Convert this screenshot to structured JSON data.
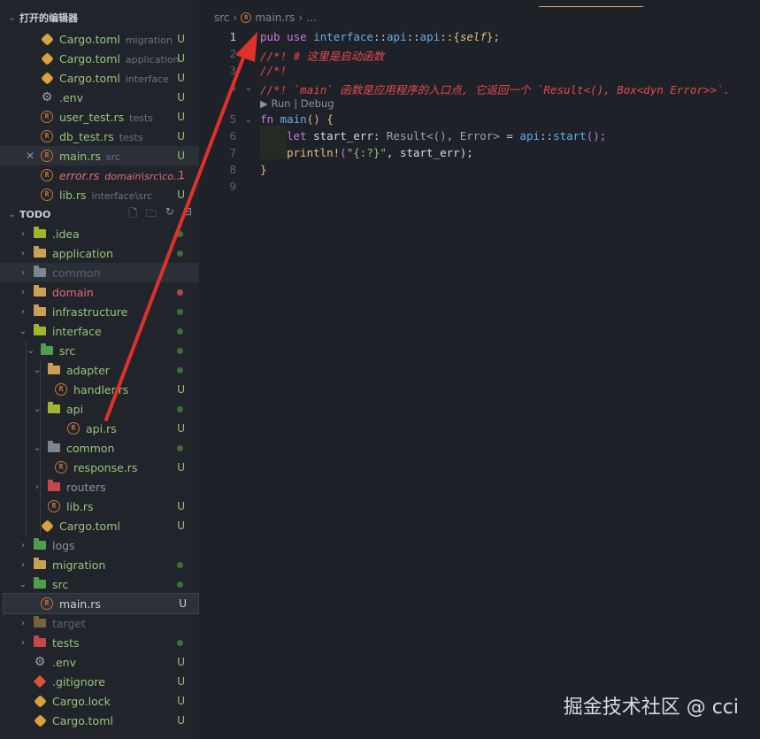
{
  "open_editors": {
    "title": "打开的编辑器",
    "items": [
      {
        "icon": "cargo-icon",
        "name": "Cargo.toml",
        "desc": "migration",
        "status": "U"
      },
      {
        "icon": "cargo-icon",
        "name": "Cargo.toml",
        "desc": "application",
        "status": "U"
      },
      {
        "icon": "cargo-icon",
        "name": "Cargo.toml",
        "desc": "interface",
        "status": "U"
      },
      {
        "icon": "gear-icon",
        "name": ".env",
        "desc": "",
        "status": "U"
      },
      {
        "icon": "rust-icon",
        "name": "user_test.rs",
        "desc": "tests",
        "status": "U"
      },
      {
        "icon": "rust-icon",
        "name": "db_test.rs",
        "desc": "tests",
        "status": "U"
      },
      {
        "icon": "rust-icon",
        "name": "main.rs",
        "desc": "src",
        "status": "U",
        "close": "✕"
      },
      {
        "icon": "rust-icon",
        "name": "error.rs",
        "desc": "domain\\src\\co...",
        "status": "1"
      },
      {
        "icon": "rust-icon",
        "name": "lib.rs",
        "desc": "interface\\src",
        "status": "U"
      }
    ]
  },
  "explorer": {
    "title": "TODO",
    "tree": [
      {
        "name": ".idea",
        "status": ""
      },
      {
        "name": "application",
        "status": ""
      },
      {
        "name": "common",
        "status": ""
      },
      {
        "name": "domain",
        "status": ""
      },
      {
        "name": "infrastructure",
        "status": ""
      },
      {
        "name": "interface",
        "status": ""
      },
      {
        "name": "src",
        "status": ""
      },
      {
        "name": "adapter",
        "status": ""
      },
      {
        "name": "handler.rs",
        "status": "U"
      },
      {
        "name": "api",
        "status": ""
      },
      {
        "name": "api.rs",
        "status": "U"
      },
      {
        "name": "common",
        "status": ""
      },
      {
        "name": "response.rs",
        "status": "U"
      },
      {
        "name": "routers",
        "status": ""
      },
      {
        "name": "lib.rs",
        "status": "U"
      },
      {
        "name": "Cargo.toml",
        "status": "U"
      },
      {
        "name": "logs",
        "status": ""
      },
      {
        "name": "migration",
        "status": ""
      },
      {
        "name": "src",
        "status": ""
      },
      {
        "name": "main.rs",
        "status": "U"
      },
      {
        "name": "target",
        "status": ""
      },
      {
        "name": "tests",
        "status": ""
      },
      {
        "name": ".env",
        "status": "U"
      },
      {
        "name": ".gitignore",
        "status": "U"
      },
      {
        "name": "Cargo.lock",
        "status": "U"
      },
      {
        "name": "Cargo.toml",
        "status": "U"
      }
    ]
  },
  "breadcrumb": {
    "folder": "src",
    "file": "main.rs",
    "more": "..."
  },
  "editor": {
    "line_numbers": [
      "1",
      "2",
      "3",
      "4",
      "5",
      "6",
      "7",
      "8",
      "9"
    ],
    "codelens": "▶ Run | Debug",
    "lines": {
      "l1": {
        "pub": "pub use ",
        "p1": "interface",
        "s1": "::",
        "p2": "api",
        "s2": "::",
        "p3": "api",
        "s3": "::{",
        "self": "self",
        "end": "};"
      },
      "l2": "//*! # 这里是启动函数",
      "l3": "//*!",
      "l4": "//*! `main` 函数是应用程序的入口点, 它返回一个 `Result<(), Box<dyn Error>>`.",
      "l5": {
        "fn": "fn ",
        "name": "main",
        "rest": "() {"
      },
      "l6": {
        "let": "let ",
        "v": "start_err",
        "c": ": ",
        "t": "Result<(), Error>",
        "eq": " = ",
        "api": "api",
        "sep": "::",
        "call": "start",
        "end": "();"
      },
      "l7": {
        "mac": "println!",
        "o": "(",
        "str": "\"{:?}\"",
        "rest": ", start_err);"
      },
      "l8": "}"
    }
  },
  "watermark": "掘金技术社区 @ cci",
  "colors": {
    "annotation_arrow": "#e0302a",
    "untracked": "#98c379",
    "error": "#e06c75"
  }
}
